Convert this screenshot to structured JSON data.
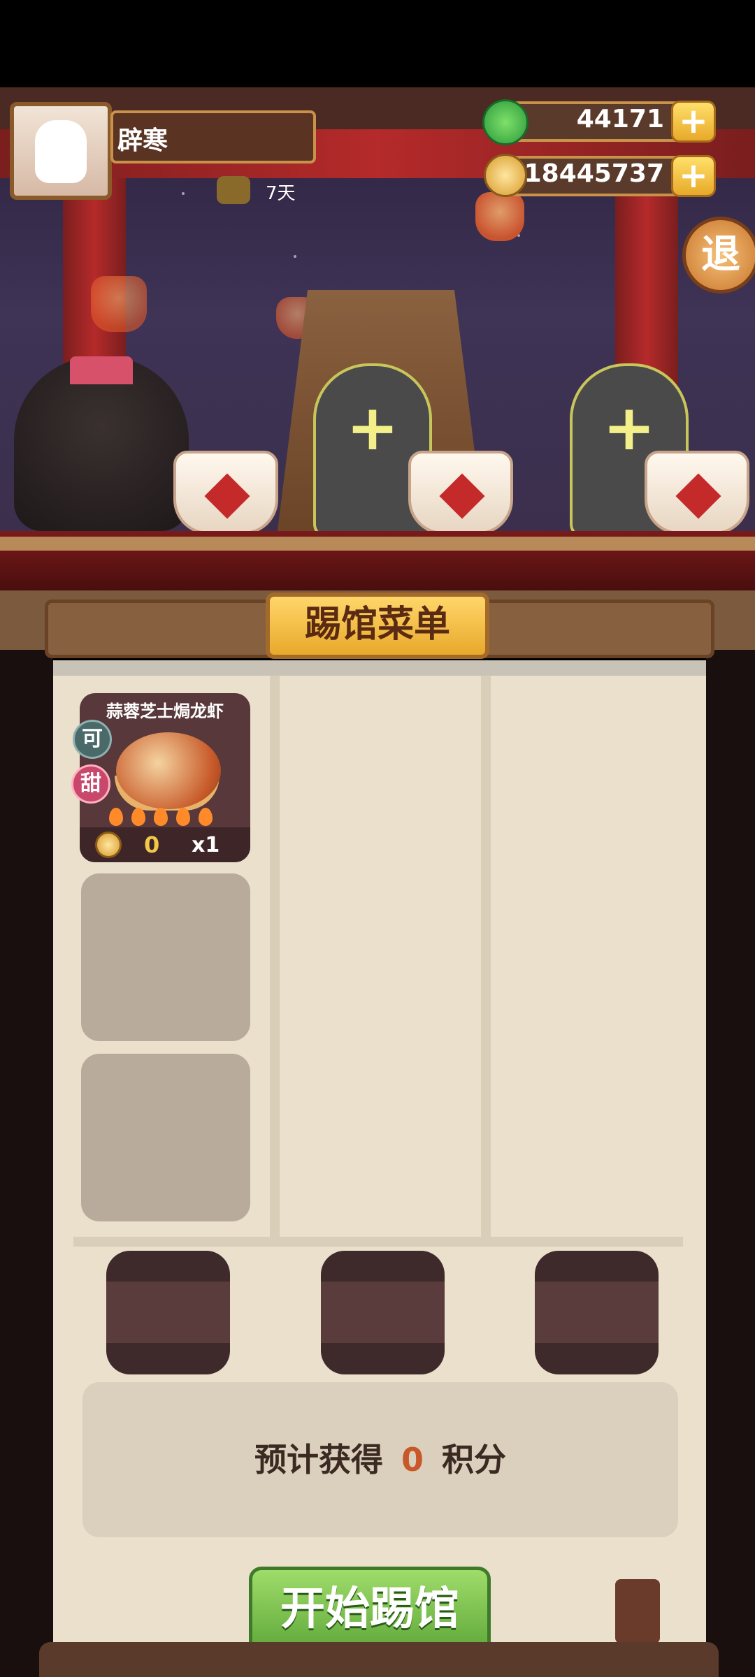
{
  "player": {
    "name": "辟寒",
    "days": "7天"
  },
  "resources": {
    "jade": "44171",
    "gold": "18445737"
  },
  "exit_label": "退",
  "panel": {
    "title": "踢馆菜单",
    "dish": {
      "name": "蒜蓉芝士焗龙虾",
      "tag1": "可",
      "tag2": "甜",
      "cost": "0",
      "qty": "x1"
    },
    "score": {
      "prefix": "预计获得",
      "value": "0",
      "suffix": "积分"
    },
    "start_button": "开始踢馆"
  },
  "colors": {
    "accent": "#e8a92a",
    "green": "#5fa83a",
    "score_number": "#c8582a"
  }
}
